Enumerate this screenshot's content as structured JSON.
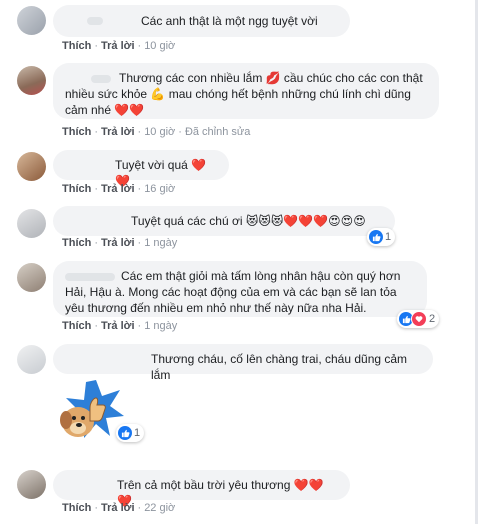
{
  "actions": {
    "like": "Thích",
    "reply": "Trả lời",
    "edited": "Đã chỉnh sửa",
    "separator": "·"
  },
  "comments": [
    {
      "text": "Các anh thật là một ngg tuyệt vời",
      "time": "10 giờ"
    },
    {
      "text": "Thương các con nhiều lắm 💋 cầu chúc cho các con thật nhiều sức khỏe 💪 mau chóng hết bệnh những chú lính chì dũng cảm nhé ❤️❤️",
      "time": "10 giờ"
    },
    {
      "text": "Tuyệt vời quá ❤️❤️",
      "time": "16 giờ"
    },
    {
      "text": "Tuyệt quá các chú ơi 😻😻😻❤️❤️❤️😍😍😍",
      "time": "1 ngày",
      "reaction_count": "1"
    },
    {
      "text": "Các em thật giỏi mà tấm lòng nhân hậu còn quý hơn Hải, Hậu à. Mong các hoạt động của em và các bạn sẽ lan tỏa yêu thương đến nhiều em nhỏ như thế này nữa nha Hải.",
      "time": "1 ngày",
      "reaction_count": "2"
    },
    {
      "text": "Thương cháu, cố lên chàng trai, cháu dũng cảm lắm",
      "time": "",
      "reaction_count": "1"
    },
    {
      "text": "Trên cả một bầu trời yêu thương ❤️❤️❤️",
      "time": "22 giờ"
    }
  ],
  "colors": {
    "bubble": "#f2f3f5",
    "link": "#4b4f56",
    "like_blue": "#1877f2",
    "love_red": "#f33e58"
  },
  "icons": [
    "like-icon",
    "love-icon",
    "sticker-dog-thumbs-up"
  ]
}
